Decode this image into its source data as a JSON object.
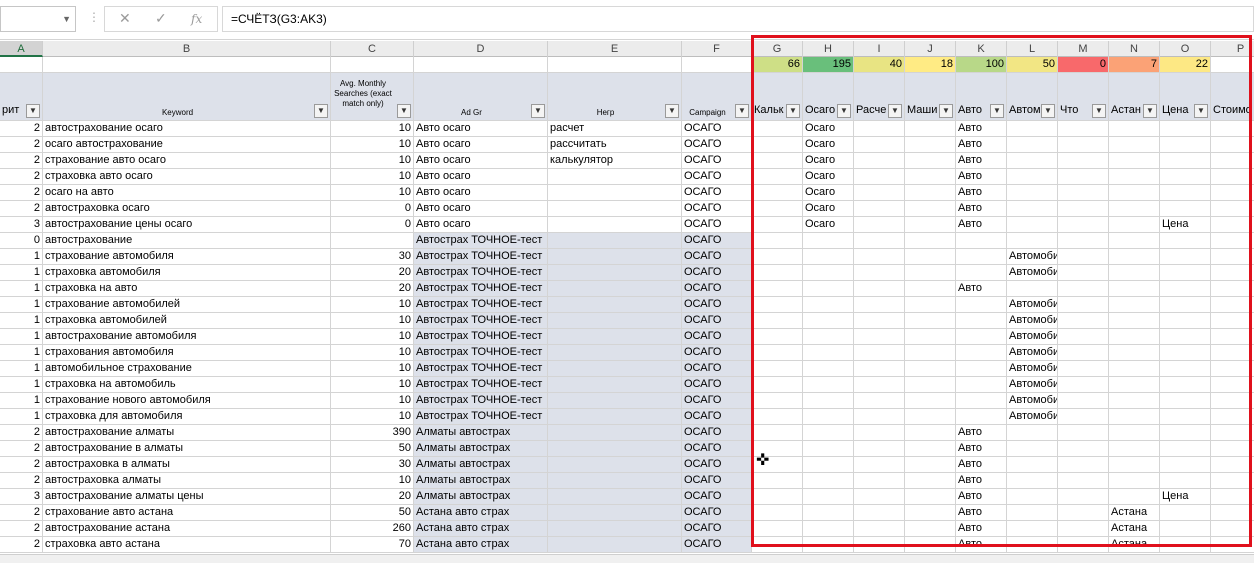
{
  "formula_bar": {
    "name_box": "",
    "formula": "=СЧЁТЗ(G3:AK3)",
    "cancel_glyph": "✕",
    "enter_glyph": "✓",
    "fx_glyph": "fx"
  },
  "columns": [
    "A",
    "B",
    "C",
    "D",
    "E",
    "F",
    "G",
    "H",
    "I",
    "J",
    "K",
    "L",
    "M",
    "N",
    "O",
    "P"
  ],
  "counts": {
    "G": "66",
    "H": "195",
    "I": "40",
    "J": "18",
    "K": "100",
    "L": "50",
    "M": "0",
    "N": "7",
    "O": "22",
    "P": ""
  },
  "count_colors": {
    "G": "#cedf86",
    "H": "#69bf7b",
    "I": "#e8e483",
    "J": "#ffeb84",
    "K": "#b8d888",
    "L": "#f2e684",
    "M": "#f8696b",
    "N": "#fba276",
    "O": "#fde884",
    "P": "#ffffff"
  },
  "headers": {
    "A": "рит",
    "B": "Keyword",
    "C": "Avg. Monthly Searches (exact match only)",
    "D": "Ad Gr",
    "E": "Негр",
    "F": "Campaign",
    "G": "Кальк",
    "H": "Осаго",
    "I": "Расче",
    "J": "Маши",
    "K": "Авто",
    "L": "Автом",
    "M": "Что",
    "N": "Астан",
    "O": "Цена",
    "P": "Стоимо"
  },
  "rows": [
    {
      "A": "2",
      "B": "автострахование осаго",
      "C": "10",
      "D": "Авто осаго",
      "E": "расчет",
      "F": "ОСАГО",
      "H": "Осаго",
      "K": "Авто"
    },
    {
      "A": "2",
      "B": "осаго автострахование",
      "C": "10",
      "D": "Авто осаго",
      "E": "рассчитать",
      "F": "ОСАГО",
      "H": "Осаго",
      "K": "Авто"
    },
    {
      "A": "2",
      "B": "страхование авто осаго",
      "C": "10",
      "D": "Авто осаго",
      "E": "калькулятор",
      "F": "ОСАГО",
      "H": "Осаго",
      "K": "Авто"
    },
    {
      "A": "2",
      "B": "страховка авто осаго",
      "C": "10",
      "D": "Авто осаго",
      "F": "ОСАГО",
      "H": "Осаго",
      "K": "Авто"
    },
    {
      "A": "2",
      "B": "осаго на авто",
      "C": "10",
      "D": "Авто осаго",
      "F": "ОСАГО",
      "H": "Осаго",
      "K": "Авто"
    },
    {
      "A": "2",
      "B": "автостраховка осаго",
      "C": "0",
      "D": "Авто осаго",
      "F": "ОСАГО",
      "H": "Осаго",
      "K": "Авто"
    },
    {
      "A": "3",
      "B": "автострахование цены осаго",
      "C": "0",
      "D": "Авто осаго",
      "F": "ОСАГО",
      "H": "Осаго",
      "K": "Авто",
      "O": "Цена"
    },
    {
      "A": "0",
      "B": "автострахование",
      "D": "Автострах ТОЧНОЕ-тест",
      "F": "ОСАГО"
    },
    {
      "A": "1",
      "B": "страхование автомобиля",
      "C": "30",
      "D": "Автострах ТОЧНОЕ-тест",
      "F": "ОСАГО",
      "L": "Автомобил"
    },
    {
      "A": "1",
      "B": "страховка автомобиля",
      "C": "20",
      "D": "Автострах ТОЧНОЕ-тест",
      "F": "ОСАГО",
      "L": "Автомобил"
    },
    {
      "A": "1",
      "B": "страховка на авто",
      "C": "20",
      "D": "Автострах ТОЧНОЕ-тест",
      "F": "ОСАГО",
      "K": "Авто"
    },
    {
      "A": "1",
      "B": "страхование автомобилей",
      "C": "10",
      "D": "Автострах ТОЧНОЕ-тест",
      "F": "ОСАГО",
      "L": "Автомобил"
    },
    {
      "A": "1",
      "B": "страховка автомобилей",
      "C": "10",
      "D": "Автострах ТОЧНОЕ-тест",
      "F": "ОСАГО",
      "L": "Автомобил"
    },
    {
      "A": "1",
      "B": "автострахование автомобиля",
      "C": "10",
      "D": "Автострах ТОЧНОЕ-тест",
      "F": "ОСАГО",
      "L": "Автомобил"
    },
    {
      "A": "1",
      "B": "страхования автомобиля",
      "C": "10",
      "D": "Автострах ТОЧНОЕ-тест",
      "F": "ОСАГО",
      "L": "Автомобил"
    },
    {
      "A": "1",
      "B": "автомобильное страхование",
      "C": "10",
      "D": "Автострах ТОЧНОЕ-тест",
      "F": "ОСАГО",
      "L": "Автомобил"
    },
    {
      "A": "1",
      "B": "страховка на автомобиль",
      "C": "10",
      "D": "Автострах ТОЧНОЕ-тест",
      "F": "ОСАГО",
      "L": "Автомобил"
    },
    {
      "A": "1",
      "B": "страхование нового автомобиля",
      "C": "10",
      "D": "Автострах ТОЧНОЕ-тест",
      "F": "ОСАГО",
      "L": "Автомобил"
    },
    {
      "A": "1",
      "B": "страховка для автомобиля",
      "C": "10",
      "D": "Автострах ТОЧНОЕ-тест",
      "F": "ОСАГО",
      "L": "Автомобил"
    },
    {
      "A": "2",
      "B": "автострахование алматы",
      "C": "390",
      "D": "Алматы автострах",
      "F": "ОСАГО",
      "K": "Авто"
    },
    {
      "A": "2",
      "B": "автострахование в алматы",
      "C": "50",
      "D": "Алматы автострах",
      "F": "ОСАГО",
      "K": "Авто"
    },
    {
      "A": "2",
      "B": "автостраховка в алматы",
      "C": "30",
      "D": "Алматы автострах",
      "F": "ОСАГО",
      "K": "Авто"
    },
    {
      "A": "2",
      "B": "автостраховка алматы",
      "C": "10",
      "D": "Алматы автострах",
      "F": "ОСАГО",
      "K": "Авто"
    },
    {
      "A": "3",
      "B": "автострахование алматы цены",
      "C": "20",
      "D": "Алматы автострах",
      "F": "ОСАГО",
      "K": "Авто",
      "O": "Цена"
    },
    {
      "A": "2",
      "B": "страхование авто астана",
      "C": "50",
      "D": "Астана авто страх",
      "F": "ОСАГО",
      "K": "Авто",
      "N": "Астана"
    },
    {
      "A": "2",
      "B": "автострахование астана",
      "C": "260",
      "D": "Астана авто страх",
      "F": "ОСАГО",
      "K": "Авто",
      "N": "Астана"
    },
    {
      "A": "2",
      "B": "страховка авто астана",
      "C": "70",
      "D": "Астана авто страх",
      "F": "ОСАГО",
      "K": "Авто",
      "N": "Астана"
    }
  ]
}
